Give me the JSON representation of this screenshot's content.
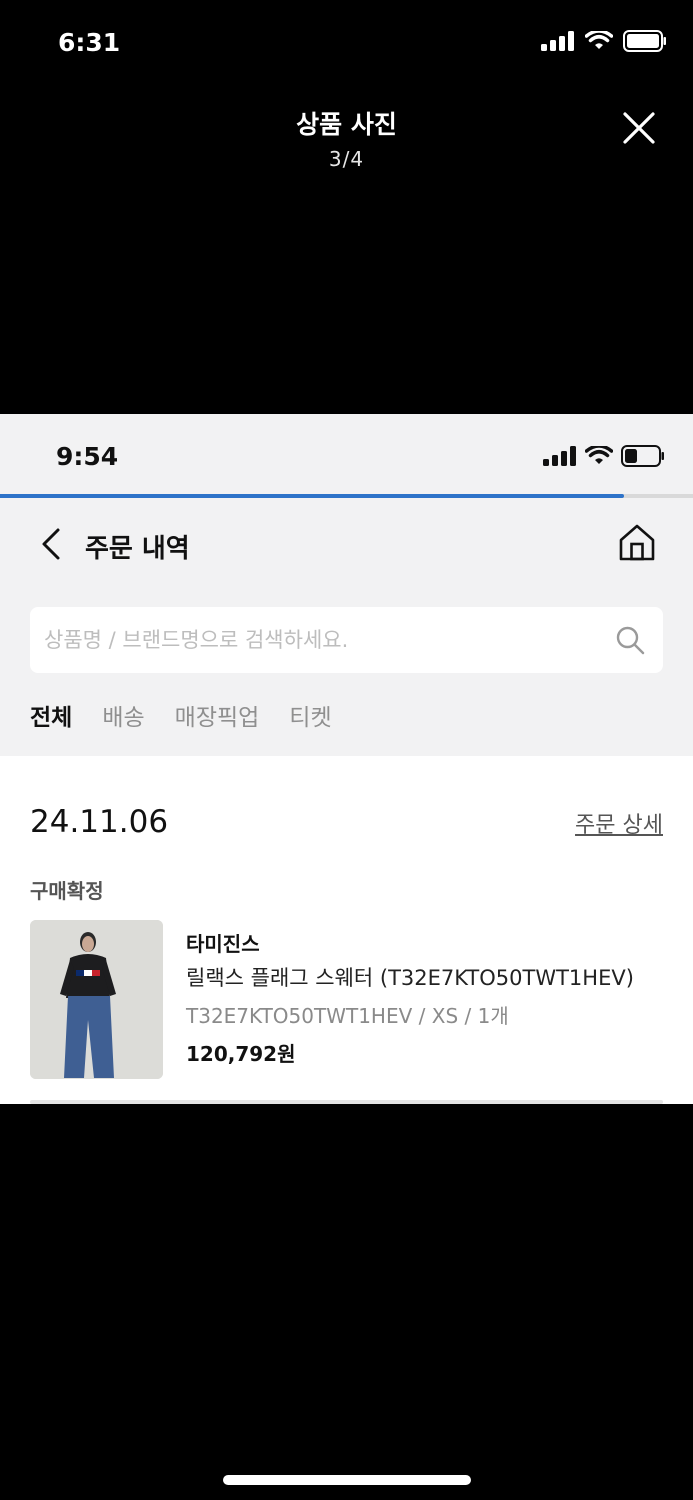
{
  "outer_status": {
    "time": "6:31"
  },
  "viewer": {
    "title": "상품 사진",
    "counter": "3/4"
  },
  "inner_status": {
    "time": "9:54"
  },
  "page_loading_progress": 0.9,
  "header": {
    "title": "주문 내역"
  },
  "search": {
    "placeholder": "상품명 / 브랜드명으로 검색하세요."
  },
  "tabs": [
    {
      "label": "전체",
      "active": true
    },
    {
      "label": "배송",
      "active": false
    },
    {
      "label": "매장픽업",
      "active": false
    },
    {
      "label": "티켓",
      "active": false
    }
  ],
  "order": {
    "date": "24.11.06",
    "detail_link": "주문 상세",
    "status": "구매확정",
    "item": {
      "brand": "타미진스",
      "name": "릴랙스 플래그 스웨터 (T32E7KTO50TWT1HEV)",
      "option": "T32E7KTO50TWT1HEV / XS / 1개",
      "price": "120,792원"
    }
  },
  "colors": {
    "accent": "#2e73c9",
    "background": "#000000",
    "panel": "#f2f2f3"
  }
}
